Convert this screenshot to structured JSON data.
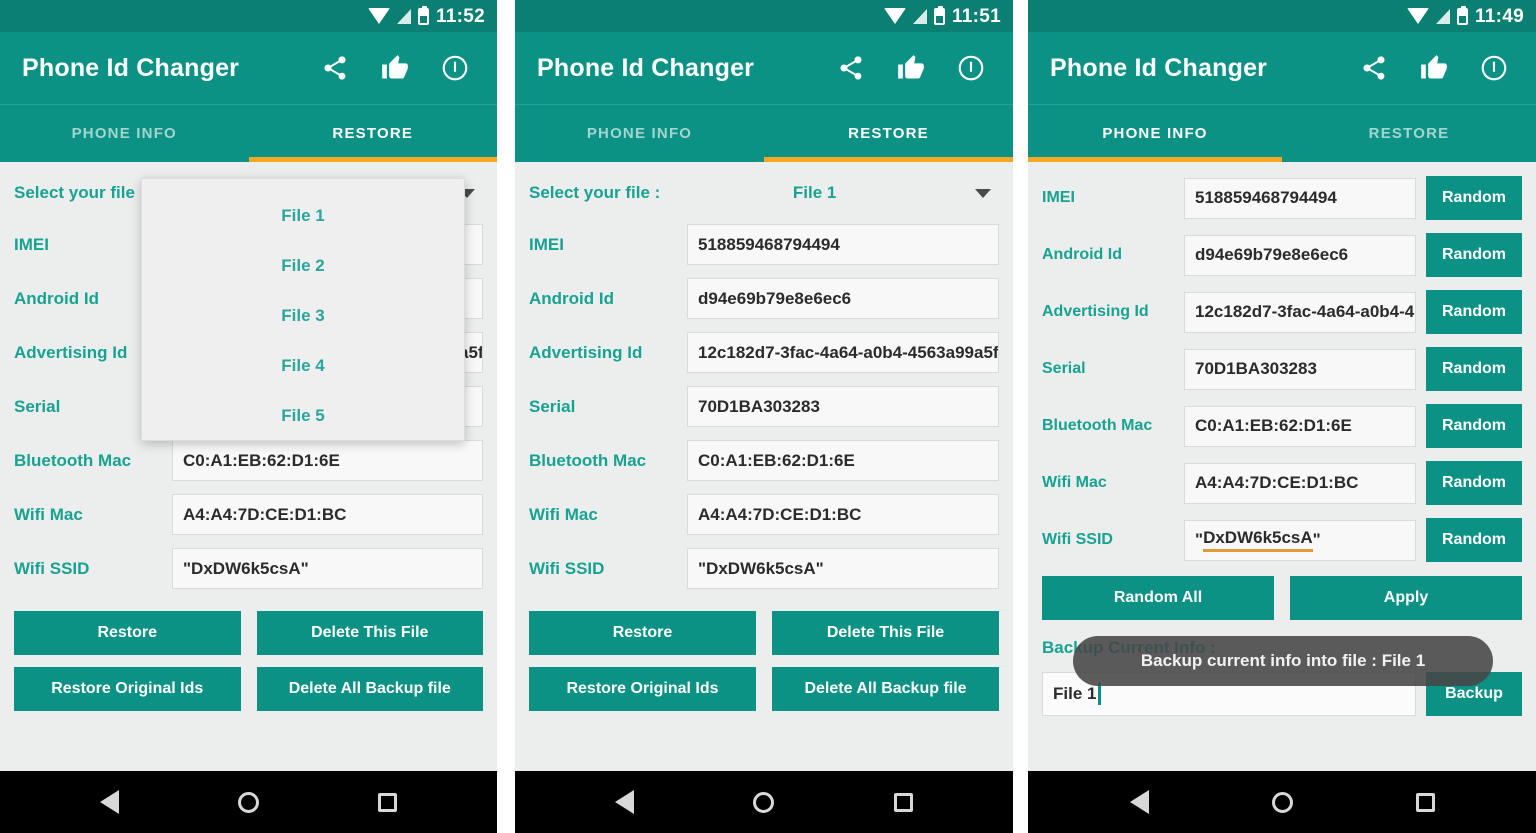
{
  "app": {
    "title": "Phone Id Changer",
    "actions": [
      {
        "name": "share-icon"
      },
      {
        "name": "thumbs-up-icon"
      },
      {
        "name": "info-icon"
      }
    ]
  },
  "tabs": {
    "phone_info": "PHONE INFO",
    "restore": "RESTORE"
  },
  "colors": {
    "teal": "#0b9285",
    "teal_dark": "#0a7f72",
    "label_teal": "#17a291",
    "accent_orange": "#f5a623",
    "panel_bg": "#eceded",
    "toast_bg": "#464646"
  },
  "labels": {
    "select_file": "Select your file :",
    "imei": "IMEI",
    "android_id": "Android Id",
    "advertising_id": "Advertising Id",
    "serial": "Serial",
    "bluetooth_mac": "Bluetooth Mac",
    "wifi_mac": "Wifi Mac",
    "wifi_ssid": "Wifi SSID",
    "backup_current_info": "Backup Current Info :"
  },
  "values": {
    "imei": "518859468794494",
    "android_id": "d94e69b79e8e6ec6",
    "advertising_id_full": "12c182d7-3fac-4a64-a0b4-4563a99a5f",
    "advertising_id_short": "12c182d7-3fac-4a64-a0b4-4",
    "serial": "70D1BA303283",
    "bluetooth_mac": "C0:A1:EB:62:D1:6E",
    "wifi_mac": "A4:A4:7D:CE:D1:BC",
    "wifi_ssid": "\"DxDW6k5csA\"",
    "wifi_ssid_quoted_inner": "DxDW6k5csA"
  },
  "buttons": {
    "restore": "Restore",
    "delete_this_file": "Delete This File",
    "restore_original_ids": "Restore Original Ids",
    "delete_all_backup_file": "Delete All Backup file",
    "random": "Random",
    "random_all": "Random All",
    "apply": "Apply",
    "backup": "Backup"
  },
  "dropdown": {
    "options": [
      "File 1",
      "File 2",
      "File 3",
      "File 4",
      "File 5"
    ]
  },
  "panel1": {
    "time": "11:52",
    "active_tab": "RESTORE",
    "selected_file": "",
    "dropdown_open": true
  },
  "panel2": {
    "time": "11:51",
    "active_tab": "RESTORE",
    "selected_file": "File 1"
  },
  "panel3": {
    "time": "11:49",
    "active_tab": "PHONE INFO",
    "backup_filename": "File 1",
    "toast": "Backup current info into file : File 1"
  }
}
